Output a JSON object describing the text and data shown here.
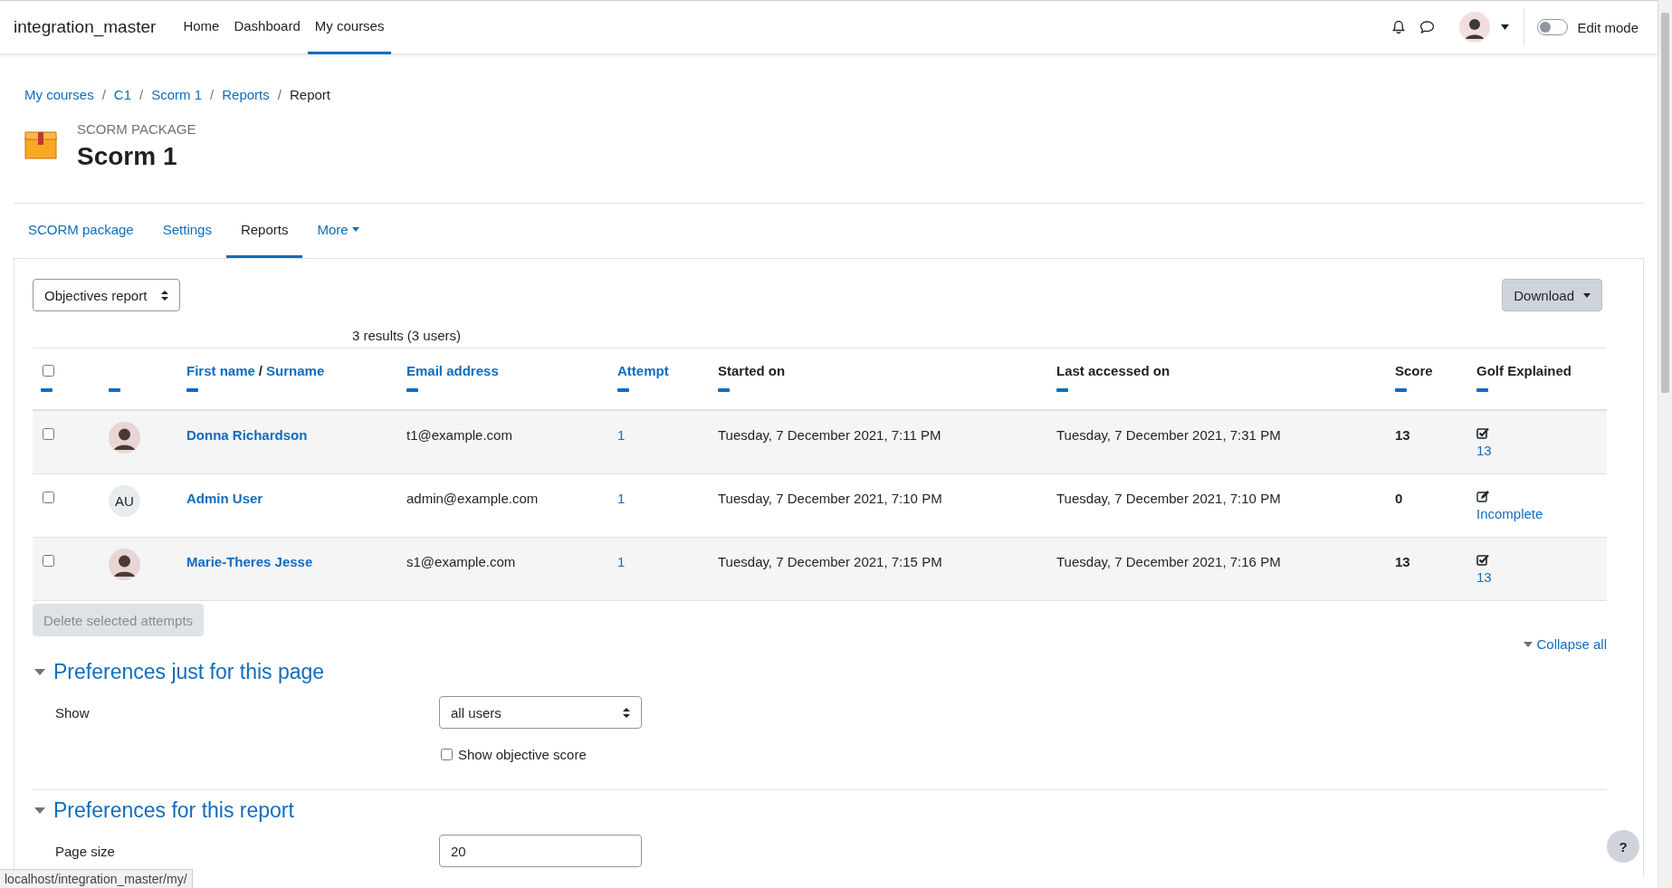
{
  "site_name": "integration_master",
  "nav": [
    {
      "label": "Home",
      "selected": false
    },
    {
      "label": "Dashboard",
      "selected": false
    },
    {
      "label": "My courses",
      "selected": true
    }
  ],
  "edit_mode": {
    "label": "Edit mode",
    "on": false
  },
  "breadcrumb": [
    {
      "label": "My courses",
      "link": true
    },
    {
      "label": "C1",
      "link": true
    },
    {
      "label": "Scorm 1",
      "link": true
    },
    {
      "label": "Reports",
      "link": true
    },
    {
      "label": "Report",
      "link": false
    }
  ],
  "breadcrumb_separator": "/",
  "header": {
    "kicker": "SCORM PACKAGE",
    "title": "Scorm 1"
  },
  "tabs": [
    {
      "label": "SCORM package",
      "selected": false,
      "dropdown": false
    },
    {
      "label": "Settings",
      "selected": false,
      "dropdown": false
    },
    {
      "label": "Reports",
      "selected": true,
      "dropdown": false
    },
    {
      "label": "More",
      "selected": false,
      "dropdown": true
    }
  ],
  "report_select": {
    "value": "Objectives report"
  },
  "download_button": "Download",
  "results": "3 results (3 users)",
  "table": {
    "columns": [
      {
        "kind": "checkbox",
        "checked": false
      },
      {
        "kind": "blank"
      },
      {
        "kind": "pair",
        "label": "First name",
        "separator": "/",
        "label2": "Surname"
      },
      {
        "kind": "sortable",
        "label": "Email address"
      },
      {
        "kind": "sortable",
        "label": "Attempt"
      },
      {
        "kind": "plain",
        "label": "Started on"
      },
      {
        "kind": "plain",
        "label": "Last accessed on"
      },
      {
        "kind": "plain",
        "label": "Score"
      },
      {
        "kind": "plain",
        "label": "Golf Explained"
      }
    ],
    "rows": [
      {
        "selected": false,
        "avatar": {
          "kind": "photo"
        },
        "name": "Donna Richardson",
        "email": "t1@example.com",
        "attempt": "1",
        "started": "Tuesday, 7 December 2021, 7:11 PM",
        "last": "Tuesday, 7 December 2021, 7:31 PM",
        "score": "13",
        "golf": {
          "kind": "complete",
          "label": "13"
        }
      },
      {
        "selected": false,
        "avatar": {
          "kind": "initials",
          "text": "AU"
        },
        "name": "Admin User",
        "email": "admin@example.com",
        "attempt": "1",
        "started": "Tuesday, 7 December 2021, 7:10 PM",
        "last": "Tuesday, 7 December 2021, 7:10 PM",
        "score": "0",
        "golf": {
          "kind": "incomplete",
          "label": "Incomplete"
        }
      },
      {
        "selected": false,
        "avatar": {
          "kind": "photo"
        },
        "name": "Marie-Theres Jesse",
        "email": "s1@example.com",
        "attempt": "1",
        "started": "Tuesday, 7 December 2021, 7:15 PM",
        "last": "Tuesday, 7 December 2021, 7:16 PM",
        "score": "13",
        "golf": {
          "kind": "complete",
          "label": "13"
        }
      }
    ]
  },
  "delete_button": {
    "label": "Delete selected attempts",
    "disabled": true
  },
  "collapse_all": "Collapse all",
  "sections": [
    {
      "title": "Preferences just for this page",
      "expanded": true,
      "fields": [
        {
          "kind": "select",
          "label": "Show",
          "value": "all users"
        },
        {
          "kind": "checkbox",
          "label": "Show objective score",
          "checked": false
        }
      ]
    },
    {
      "title": "Preferences for this report",
      "expanded": true,
      "fields": [
        {
          "kind": "text",
          "label": "Page size",
          "value": "20"
        }
      ]
    }
  ],
  "help_button": "?",
  "status_url": "localhost/integration_master/my/"
}
